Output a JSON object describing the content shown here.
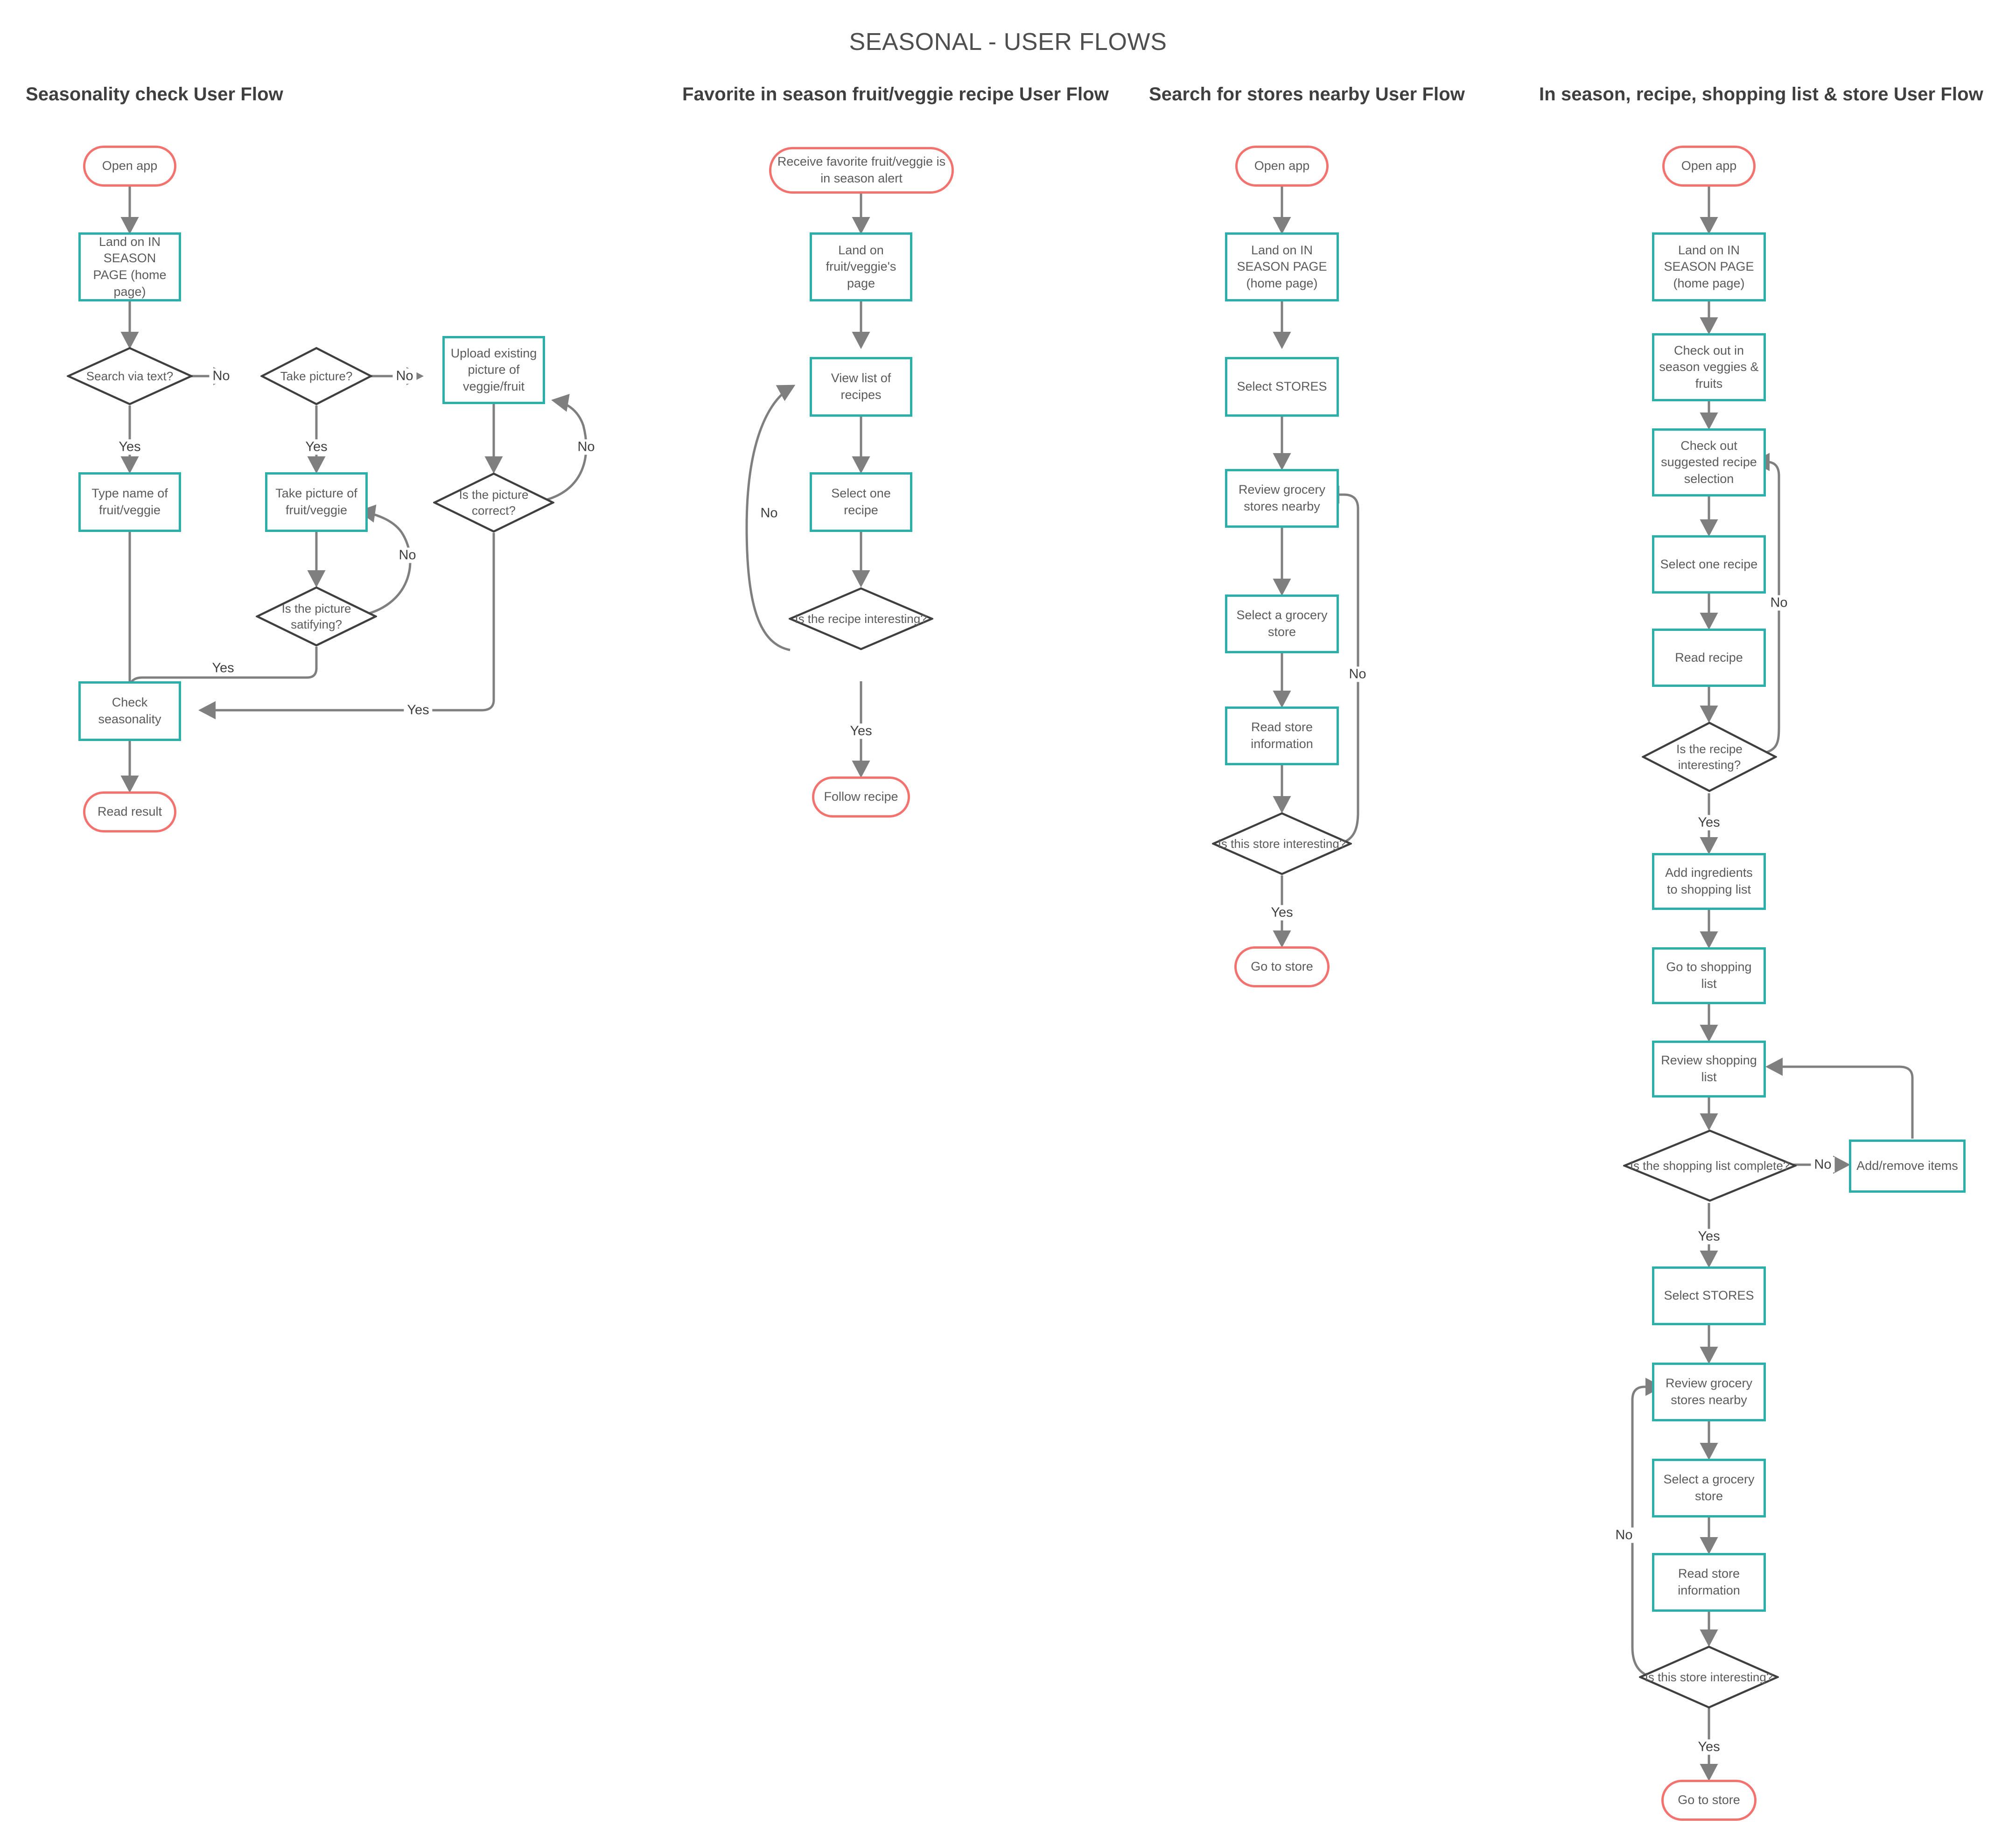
{
  "page": {
    "title": "SEASONAL - USER FLOWS",
    "colors": {
      "terminal_border": "#f4726e",
      "process_border": "#2aafab",
      "decision_border": "#3f3f3f",
      "connector": "#7f7f7f",
      "text": "#5b5b5b"
    }
  },
  "flows": [
    {
      "id": "seasonality-check",
      "title": "Seasonality check User Flow",
      "nodes": [
        {
          "id": "f1-open-app",
          "type": "terminal",
          "label": "Open app"
        },
        {
          "id": "f1-land-in-season",
          "type": "process",
          "label": "Land on IN SEASON PAGE (home page)"
        },
        {
          "id": "f1-search-via-text",
          "type": "decision",
          "label": "Search via text?"
        },
        {
          "id": "f1-take-picture",
          "type": "decision",
          "label": "Take picture?"
        },
        {
          "id": "f1-upload-existing",
          "type": "process",
          "label": "Upload existing picture of veggie/fruit"
        },
        {
          "id": "f1-type-name",
          "type": "process",
          "label": "Type name of fruit/veggie"
        },
        {
          "id": "f1-take-picture-of",
          "type": "process",
          "label": "Take picture of fruit/veggie"
        },
        {
          "id": "f1-picture-correct",
          "type": "decision",
          "label": "Is the picture correct?"
        },
        {
          "id": "f1-picture-satify",
          "type": "decision",
          "label": "Is the picture satifying?"
        },
        {
          "id": "f1-check-seasonality",
          "type": "process",
          "label": "Check seasonality"
        },
        {
          "id": "f1-read-result",
          "type": "terminal",
          "label": "Read result"
        }
      ],
      "edge_labels": [
        "No",
        "No",
        "Yes",
        "Yes",
        "No",
        "No",
        "Yes",
        "Yes"
      ]
    },
    {
      "id": "favorite-recipe",
      "title": "Favorite in season fruit/veggie recipe User Flow",
      "nodes": [
        {
          "id": "f2-receive-alert",
          "type": "terminal",
          "label": "Receive favorite fruit/veggie is in season alert"
        },
        {
          "id": "f2-land-page",
          "type": "process",
          "label": "Land on fruit/veggie's page"
        },
        {
          "id": "f2-view-list",
          "type": "process",
          "label": "View list of recipes"
        },
        {
          "id": "f2-select-recipe",
          "type": "process",
          "label": "Select one recipe"
        },
        {
          "id": "f2-recipe-interest",
          "type": "decision",
          "label": "Is the recipe interesting?"
        },
        {
          "id": "f2-follow-recipe",
          "type": "terminal",
          "label": "Follow recipe"
        }
      ],
      "edge_labels": [
        "No",
        "Yes"
      ]
    },
    {
      "id": "search-stores",
      "title": "Search for stores nearby User Flow",
      "nodes": [
        {
          "id": "f3-open-app",
          "type": "terminal",
          "label": "Open app"
        },
        {
          "id": "f3-land-in-season",
          "type": "process",
          "label": "Land on IN SEASON PAGE (home page)"
        },
        {
          "id": "f3-select-stores",
          "type": "process",
          "label": "Select STORES"
        },
        {
          "id": "f3-review-stores",
          "type": "process",
          "label": "Review grocery stores nearby"
        },
        {
          "id": "f3-select-store",
          "type": "process",
          "label": "Select a grocery store"
        },
        {
          "id": "f3-read-store-info",
          "type": "process",
          "label": "Read store information"
        },
        {
          "id": "f3-store-interest",
          "type": "decision",
          "label": "Is this store interesting?"
        },
        {
          "id": "f3-go-to-store",
          "type": "terminal",
          "label": "Go to store"
        }
      ],
      "edge_labels": [
        "No",
        "Yes"
      ]
    },
    {
      "id": "in-season-full",
      "title": "In season, recipe, shopping list & store User Flow",
      "nodes": [
        {
          "id": "f4-open-app",
          "type": "terminal",
          "label": "Open app"
        },
        {
          "id": "f4-land-in-season",
          "type": "process",
          "label": "Land on IN SEASON PAGE (home page)"
        },
        {
          "id": "f4-check-veggies",
          "type": "process",
          "label": "Check out in season veggies & fruits"
        },
        {
          "id": "f4-check-recipes",
          "type": "process",
          "label": "Check out suggested recipe selection"
        },
        {
          "id": "f4-select-recipe",
          "type": "process",
          "label": "Select one recipe"
        },
        {
          "id": "f4-read-recipe",
          "type": "process",
          "label": "Read recipe"
        },
        {
          "id": "f4-recipe-interest",
          "type": "decision",
          "label": "Is the recipe interesting?"
        },
        {
          "id": "f4-add-ingredients",
          "type": "process",
          "label": "Add ingredients to shopping list"
        },
        {
          "id": "f4-go-shopping-list",
          "type": "process",
          "label": "Go to shopping list"
        },
        {
          "id": "f4-review-list",
          "type": "process",
          "label": "Review shopping list"
        },
        {
          "id": "f4-list-complete",
          "type": "decision",
          "label": "Is the shopping list complete?"
        },
        {
          "id": "f4-add-remove",
          "type": "process",
          "label": "Add/remove items"
        },
        {
          "id": "f4-select-stores",
          "type": "process",
          "label": "Select STORES"
        },
        {
          "id": "f4-review-stores",
          "type": "process",
          "label": "Review grocery stores nearby"
        },
        {
          "id": "f4-select-store",
          "type": "process",
          "label": "Select a grocery store"
        },
        {
          "id": "f4-read-store-info",
          "type": "process",
          "label": "Read store information"
        },
        {
          "id": "f4-store-interest",
          "type": "decision",
          "label": "Is this store interesting?"
        },
        {
          "id": "f4-go-to-store",
          "type": "terminal",
          "label": "Go to store"
        }
      ],
      "edge_labels": [
        "No",
        "Yes",
        "No",
        "Yes",
        "No",
        "Yes"
      ]
    }
  ]
}
